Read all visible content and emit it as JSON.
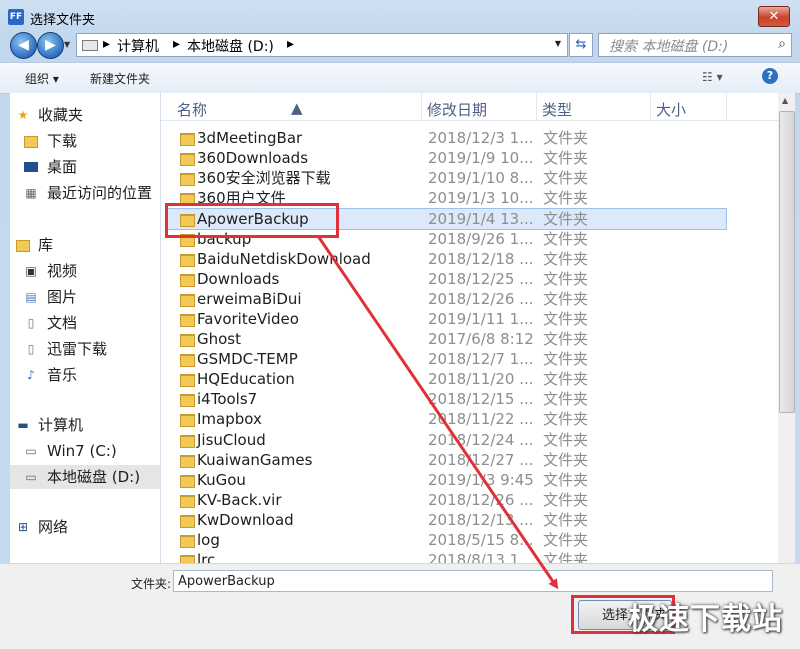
{
  "window": {
    "app_icon": "FF",
    "title": "选择文件夹",
    "close": "✕"
  },
  "nav": {
    "back": "◀",
    "forward": "▶",
    "breadcrumbs": [
      "计算机",
      "本地磁盘 (D:)"
    ],
    "search_placeholder": "搜索 本地磁盘 (D:)"
  },
  "toolbar": {
    "organize": "组织 ▾",
    "new_folder": "新建文件夹",
    "help": "?"
  },
  "sidebar": {
    "favorites": "收藏夹",
    "fav_items": [
      "下载",
      "桌面",
      "最近访问的位置"
    ],
    "libraries": "库",
    "lib_items": [
      "视频",
      "图片",
      "文档",
      "迅雷下载",
      "音乐"
    ],
    "computer": "计算机",
    "drives": [
      "Win7 (C:)",
      "本地磁盘 (D:)"
    ],
    "network": "网络"
  },
  "columns": {
    "name": "名称",
    "modified": "修改日期",
    "type": "类型",
    "size": "大小"
  },
  "files": [
    {
      "name": "3dMeetingBar",
      "date": "2018/12/3 1...",
      "type": "文件夹"
    },
    {
      "name": "360Downloads",
      "date": "2019/1/9 10...",
      "type": "文件夹"
    },
    {
      "name": "360安全浏览器下载",
      "date": "2019/1/10 8...",
      "type": "文件夹"
    },
    {
      "name": "360用户文件",
      "date": "2019/1/3 10...",
      "type": "文件夹"
    },
    {
      "name": "ApowerBackup",
      "date": "2019/1/4 13...",
      "type": "文件夹",
      "selected": true
    },
    {
      "name": "backup",
      "date": "2018/9/26 1...",
      "type": "文件夹"
    },
    {
      "name": "BaiduNetdiskDownload",
      "date": "2018/12/18 ...",
      "type": "文件夹"
    },
    {
      "name": "Downloads",
      "date": "2018/12/25 ...",
      "type": "文件夹"
    },
    {
      "name": "erweimaBiDui",
      "date": "2018/12/26 ...",
      "type": "文件夹"
    },
    {
      "name": "FavoriteVideo",
      "date": "2019/1/11 1...",
      "type": "文件夹"
    },
    {
      "name": "Ghost",
      "date": "2017/6/8 8:12",
      "type": "文件夹"
    },
    {
      "name": "GSMDC-TEMP",
      "date": "2018/12/7 1...",
      "type": "文件夹"
    },
    {
      "name": "HQEducation",
      "date": "2018/11/20 ...",
      "type": "文件夹"
    },
    {
      "name": "i4Tools7",
      "date": "2018/12/15 ...",
      "type": "文件夹"
    },
    {
      "name": "Imapbox",
      "date": "2018/11/22 ...",
      "type": "文件夹"
    },
    {
      "name": "JisuCloud",
      "date": "2018/12/24 ...",
      "type": "文件夹"
    },
    {
      "name": "KuaiwanGames",
      "date": "2018/12/27 ...",
      "type": "文件夹"
    },
    {
      "name": "KuGou",
      "date": "2019/1/3 9:45",
      "type": "文件夹"
    },
    {
      "name": "KV-Back.vir",
      "date": "2018/12/26 ...",
      "type": "文件夹"
    },
    {
      "name": "KwDownload",
      "date": "2018/12/13 ...",
      "type": "文件夹"
    },
    {
      "name": "log",
      "date": "2018/5/15 8...",
      "type": "文件夹"
    },
    {
      "name": "lrc",
      "date": "2018/8/13 1...",
      "type": "文件夹"
    }
  ],
  "bottom": {
    "folder_label": "文件夹:",
    "folder_value": "ApowerBackup",
    "ok_button": "选择文件夹"
  },
  "watermark": "极速下载站",
  "colors": {
    "highlight": "#e0303a",
    "selection": "#dbe9fb"
  }
}
